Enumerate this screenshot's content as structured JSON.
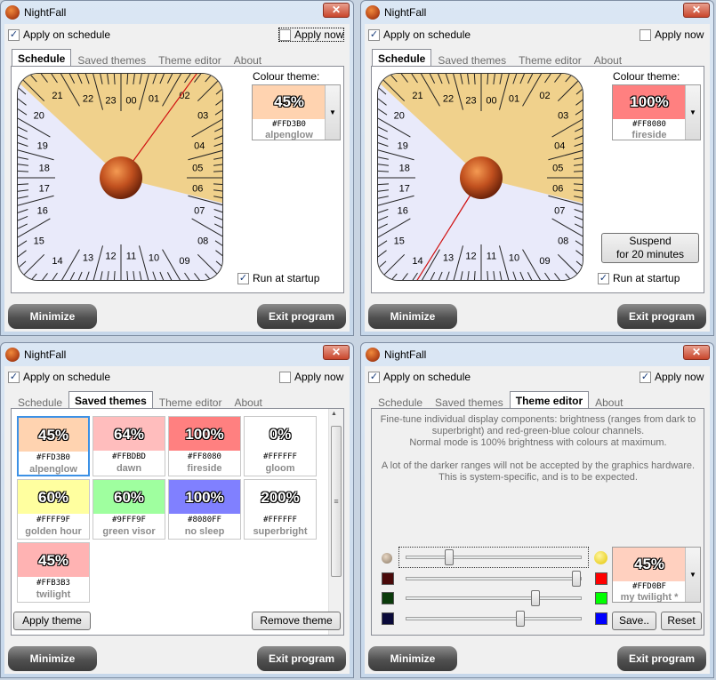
{
  "window": {
    "title": "NightFall",
    "close": "✕"
  },
  "checks": {
    "apply_schedule": "Apply on schedule",
    "apply_now": "Apply now",
    "run_startup": "Run at startup"
  },
  "tabs": [
    "Schedule",
    "Saved themes",
    "Theme editor",
    "About"
  ],
  "buttons": {
    "minimize": "Minimize",
    "exit": "Exit program",
    "suspend_line1": "Suspend",
    "suspend_line2": "for 20 minutes",
    "apply_theme": "Apply theme",
    "remove_theme": "Remove theme",
    "save": "Save..",
    "reset": "Reset"
  },
  "colour_label": "Colour theme:",
  "dial_hours": [
    "00",
    "01",
    "02",
    "03",
    "04",
    "05",
    "06",
    "07",
    "08",
    "09",
    "10",
    "11",
    "12",
    "13",
    "14",
    "15",
    "16",
    "17",
    "18",
    "19",
    "20",
    "21",
    "22",
    "23"
  ],
  "window1": {
    "theme": {
      "pct": "45%",
      "hex": "#FFD3B0",
      "name": "alpenglow",
      "color": "#ffd3b0"
    }
  },
  "window2": {
    "theme": {
      "pct": "100%",
      "hex": "#FF8080",
      "name": "fireside",
      "color": "#ff8080"
    }
  },
  "saved_themes": [
    {
      "pct": "45%",
      "hex": "#FFD3B0",
      "name": "alpenglow",
      "color": "#ffd3b0",
      "selected": true
    },
    {
      "pct": "64%",
      "hex": "#FFBDBD",
      "name": "dawn",
      "color": "#ffbdbd"
    },
    {
      "pct": "100%",
      "hex": "#FF8080",
      "name": "fireside",
      "color": "#ff8080"
    },
    {
      "pct": "0%",
      "hex": "#FFFFFF",
      "name": "gloom",
      "color": "#ffffff"
    },
    {
      "pct": "60%",
      "hex": "#FFFF9F",
      "name": "golden hour",
      "color": "#ffff9f"
    },
    {
      "pct": "60%",
      "hex": "#9FFF9F",
      "name": "green visor",
      "color": "#9fff9f"
    },
    {
      "pct": "100%",
      "hex": "#8080FF",
      "name": "no sleep",
      "color": "#8080ff"
    },
    {
      "pct": "200%",
      "hex": "#FFFFFF",
      "name": "superbright",
      "color": "#ffffff"
    },
    {
      "pct": "45%",
      "hex": "#FFB3B3",
      "name": "twilight",
      "color": "#ffb3b3"
    }
  ],
  "editor": {
    "desc1": "Fine-tune individual display components: brightness (ranges from dark to superbright) and red-green-blue colour channels.",
    "desc2": "Normal mode is 100% brightness with colours at maximum.",
    "desc3": "A lot of the darker ranges will not be accepted by the graphics hardware. This is system-specific, and is to be expected.",
    "theme": {
      "pct": "45%",
      "hex": "#FFD0BF",
      "name": "my twilight *",
      "color": "#ffd0bf"
    },
    "levels": {
      "brightness": 0.23,
      "red": 1.0,
      "green": 0.75,
      "blue": 0.66
    },
    "swatches": {
      "dark_red": "#4a0a0a",
      "red": "#ff0000",
      "dark_green": "#0a3a0a",
      "green": "#00ff00",
      "dark_blue": "#0a0a3a",
      "blue": "#0000ff"
    }
  }
}
